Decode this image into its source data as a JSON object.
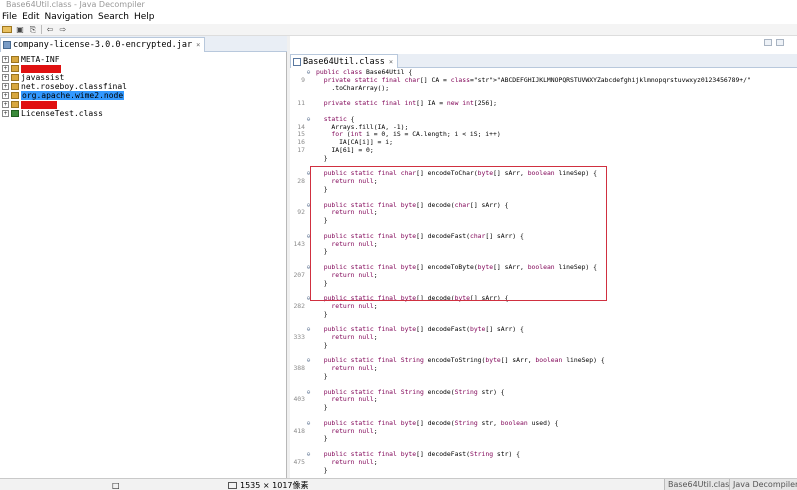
{
  "window": {
    "title": "Base64Util.class - Java Decompiler"
  },
  "menu": [
    "File",
    "Edit",
    "Navigation",
    "Search",
    "Help"
  ],
  "left_tab": {
    "label": "company-license-3.0.0-encrypted.jar",
    "close": "×"
  },
  "tree": [
    {
      "label": "META-INF",
      "kind": "pkg",
      "redacted": false,
      "selected": false
    },
    {
      "label": "",
      "kind": "pkg",
      "redacted": true,
      "selected": false
    },
    {
      "label": "javassist",
      "kind": "pkg",
      "redacted": false,
      "selected": false
    },
    {
      "label": "net.roseboy.classfinal",
      "kind": "pkg",
      "redacted": false,
      "selected": false
    },
    {
      "label": "org.apache.wime2.node",
      "kind": "pkg",
      "redacted": false,
      "selected": true
    },
    {
      "label": "",
      "kind": "pkg",
      "redacted": true,
      "selected": false
    },
    {
      "label": "LicenseTest.class",
      "kind": "class",
      "redacted": false,
      "selected": false
    }
  ],
  "right_tab": {
    "label": "Base64Util.class",
    "close": "×"
  },
  "code_lines": [
    {
      "ln": "",
      "fold": "⊖",
      "text": "public class Base64Util {"
    },
    {
      "ln": "9",
      "fold": "",
      "text": "  private static final char[] CA = \"ABCDEFGHIJKLMNOPQRSTUVWXYZabcdefghijklmnopqrstuvwxyz0123456789+/\""
    },
    {
      "ln": "",
      "fold": "",
      "text": "    .toCharArray();"
    },
    {
      "ln": "",
      "fold": "",
      "text": ""
    },
    {
      "ln": "11",
      "fold": "",
      "text": "  private static final int[] IA = new int[256];"
    },
    {
      "ln": "",
      "fold": "",
      "text": ""
    },
    {
      "ln": "",
      "fold": "⊖",
      "text": "  static {"
    },
    {
      "ln": "14",
      "fold": "",
      "text": "    Arrays.fill(IA, -1);"
    },
    {
      "ln": "15",
      "fold": "",
      "text": "    for (int i = 0, iS = CA.length; i < iS; i++)"
    },
    {
      "ln": "16",
      "fold": "",
      "text": "      IA[CA[i]] = i;"
    },
    {
      "ln": "17",
      "fold": "",
      "text": "    IA[61] = 0;"
    },
    {
      "ln": "",
      "fold": "",
      "text": "  }"
    },
    {
      "ln": "",
      "fold": "",
      "text": ""
    },
    {
      "ln": "",
      "fold": "⊖",
      "text": "  public static final char[] encodeToChar(byte[] sArr, boolean lineSep) {"
    },
    {
      "ln": "28",
      "fold": "",
      "text": "    return null;"
    },
    {
      "ln": "",
      "fold": "",
      "text": "  }"
    },
    {
      "ln": "",
      "fold": "",
      "text": ""
    },
    {
      "ln": "",
      "fold": "⊖",
      "text": "  public static final byte[] decode(char[] sArr) {"
    },
    {
      "ln": "92",
      "fold": "",
      "text": "    return null;"
    },
    {
      "ln": "",
      "fold": "",
      "text": "  }"
    },
    {
      "ln": "",
      "fold": "",
      "text": ""
    },
    {
      "ln": "",
      "fold": "⊖",
      "text": "  public static final byte[] decodeFast(char[] sArr) {"
    },
    {
      "ln": "143",
      "fold": "",
      "text": "    return null;"
    },
    {
      "ln": "",
      "fold": "",
      "text": "  }"
    },
    {
      "ln": "",
      "fold": "",
      "text": ""
    },
    {
      "ln": "",
      "fold": "⊖",
      "text": "  public static final byte[] encodeToByte(byte[] sArr, boolean lineSep) {"
    },
    {
      "ln": "207",
      "fold": "",
      "text": "    return null;"
    },
    {
      "ln": "",
      "fold": "",
      "text": "  }"
    },
    {
      "ln": "",
      "fold": "",
      "text": ""
    },
    {
      "ln": "",
      "fold": "⊖",
      "text": "  public static final byte[] decode(byte[] sArr) {"
    },
    {
      "ln": "282",
      "fold": "",
      "text": "    return null;"
    },
    {
      "ln": "",
      "fold": "",
      "text": "  }"
    },
    {
      "ln": "",
      "fold": "",
      "text": ""
    },
    {
      "ln": "",
      "fold": "⊖",
      "text": "  public static final byte[] decodeFast(byte[] sArr) {"
    },
    {
      "ln": "333",
      "fold": "",
      "text": "    return null;"
    },
    {
      "ln": "",
      "fold": "",
      "text": "  }"
    },
    {
      "ln": "",
      "fold": "",
      "text": ""
    },
    {
      "ln": "",
      "fold": "⊖",
      "text": "  public static final String encodeToString(byte[] sArr, boolean lineSep) {"
    },
    {
      "ln": "388",
      "fold": "",
      "text": "    return null;"
    },
    {
      "ln": "",
      "fold": "",
      "text": "  }"
    },
    {
      "ln": "",
      "fold": "",
      "text": ""
    },
    {
      "ln": "",
      "fold": "⊖",
      "text": "  public static final String encode(String str) {"
    },
    {
      "ln": "403",
      "fold": "",
      "text": "    return null;"
    },
    {
      "ln": "",
      "fold": "",
      "text": "  }"
    },
    {
      "ln": "",
      "fold": "",
      "text": ""
    },
    {
      "ln": "",
      "fold": "⊖",
      "text": "  public static final byte[] decode(String str, boolean used) {"
    },
    {
      "ln": "418",
      "fold": "",
      "text": "    return null;"
    },
    {
      "ln": "",
      "fold": "",
      "text": "  }"
    },
    {
      "ln": "",
      "fold": "",
      "text": ""
    },
    {
      "ln": "",
      "fold": "⊖",
      "text": "  public static final byte[] decodeFast(String str) {"
    },
    {
      "ln": "475",
      "fold": "",
      "text": "    return null;"
    },
    {
      "ln": "",
      "fold": "",
      "text": "  }"
    }
  ],
  "status": {
    "dimensions": "1535 × 1017像素"
  },
  "taskbar": [
    "Base64Util.class",
    "Java Decompiler"
  ],
  "colors": {
    "keyword": "#7f0055",
    "string": "#2a00ff",
    "field": "#0000c0",
    "selection": "#3399ff",
    "highlight_box": "#d03040",
    "redaction": "#e01010"
  }
}
